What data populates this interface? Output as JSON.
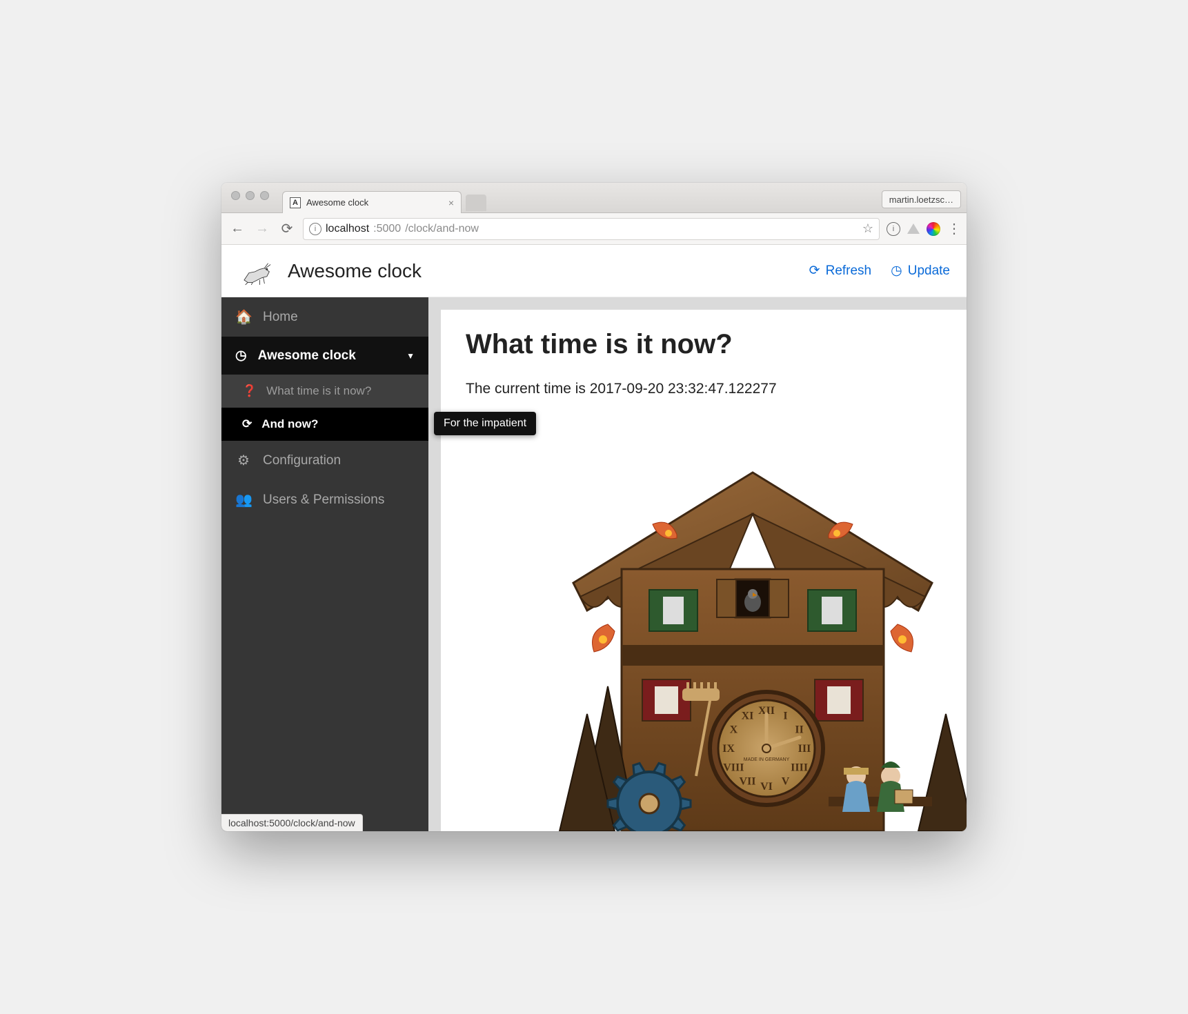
{
  "browser": {
    "tab_title": "Awesome clock",
    "profile": "martin.loetzsc…",
    "url_host": "localhost",
    "url_port": ":5000",
    "url_path": "/clock/and-now",
    "status_text": "localhost:5000/clock/and-now"
  },
  "header": {
    "title": "Awesome clock",
    "refresh": "Refresh",
    "update": "Update"
  },
  "sidebar": {
    "home": "Home",
    "section": "Awesome clock",
    "sub1": "What time is it now?",
    "sub2": "And now?",
    "config": "Configuration",
    "users": "Users & Permissions"
  },
  "content": {
    "heading": "What time is it now?",
    "text": "The current time is 2017-09-20 23:32:47.122277"
  },
  "tooltip": "For the impatient",
  "clock": {
    "numerals": [
      "XII",
      "I",
      "II",
      "III",
      "IIII",
      "V",
      "VI",
      "VII",
      "VIII",
      "IX",
      "X",
      "XI"
    ],
    "center_label": "MADE IN GERMANY"
  }
}
